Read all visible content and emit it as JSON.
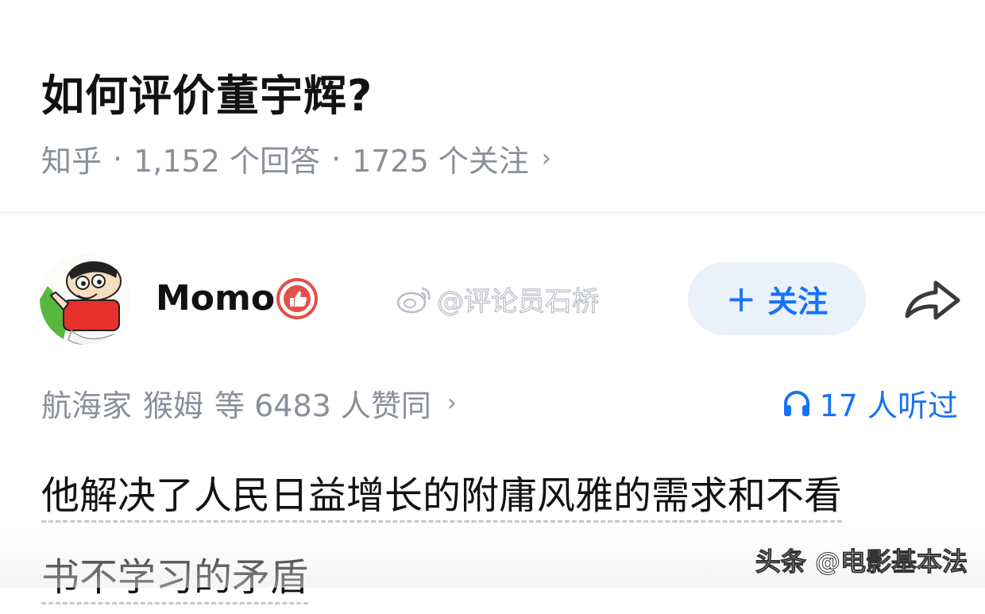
{
  "question": {
    "title": "如何评价董宇辉?",
    "source": "知乎",
    "separator": "·",
    "answers": "1,152 个回答",
    "followers": "1725 个关注",
    "chevron": "›"
  },
  "author": {
    "name": "Momo",
    "avatar_icon": "cartoon-avatar-icon",
    "badge_icon": "thumbs-up-badge-icon",
    "follow_plus": "+",
    "follow_label": "关注",
    "share_icon": "share-arrow-icon"
  },
  "watermarks": {
    "weibo": "@评论员石桥",
    "toutiao": "头条 @电影基本法"
  },
  "votes": {
    "voters_a": "航海家",
    "voters_b": "猴姆",
    "rest": "等 6483 人赞同",
    "chevron": "›"
  },
  "listen": {
    "icon": "headphones-icon",
    "label": "17 人听过"
  },
  "answer": {
    "line1": "他解决了人民日益增长的附庸风雅的需求和不看",
    "line2": "书不学习的矛盾"
  },
  "colors": {
    "accent": "#1772f6",
    "follow_bg": "#e9f1fb",
    "meta_gray": "#8a8f99",
    "badge_red": "#e2504a"
  }
}
